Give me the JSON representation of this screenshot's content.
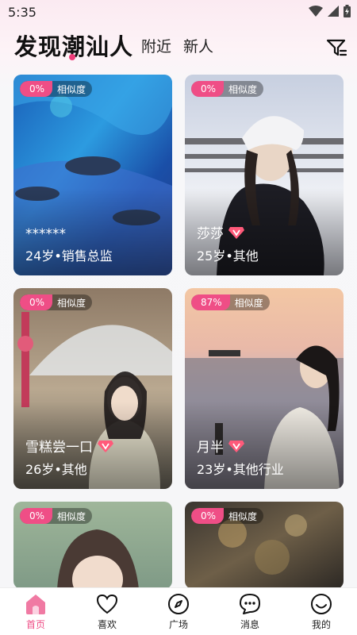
{
  "status_bar": {
    "time": "5:35"
  },
  "header": {
    "title": "发现潮汕人",
    "tabs": [
      "附近",
      "新人"
    ],
    "filter_icon": "filter-icon"
  },
  "accent_color": "#ef4e86",
  "cards": [
    {
      "match": "0%",
      "match_label": "相似度",
      "name": "******",
      "vip": false,
      "info": "24岁•销售总监"
    },
    {
      "match": "0%",
      "match_label": "相似度",
      "name": "莎莎",
      "vip": true,
      "info": "25岁•其他"
    },
    {
      "match": "0%",
      "match_label": "相似度",
      "name": "雪糕尝一口",
      "vip": true,
      "info": "26岁•其他"
    },
    {
      "match": "87%",
      "match_label": "相似度",
      "name": "月半",
      "vip": true,
      "info": "23岁•其他行业"
    },
    {
      "match": "0%",
      "match_label": "相似度",
      "name": "",
      "vip": false,
      "info": ""
    },
    {
      "match": "0%",
      "match_label": "相似度",
      "name": "",
      "vip": false,
      "info": ""
    }
  ],
  "bottom_nav": [
    {
      "label": "首页",
      "icon": "home-icon",
      "active": true
    },
    {
      "label": "喜欢",
      "icon": "heart-icon",
      "active": false
    },
    {
      "label": "广场",
      "icon": "compass-icon",
      "active": false
    },
    {
      "label": "消息",
      "icon": "message-icon",
      "active": false
    },
    {
      "label": "我的",
      "icon": "profile-icon",
      "active": false
    }
  ]
}
